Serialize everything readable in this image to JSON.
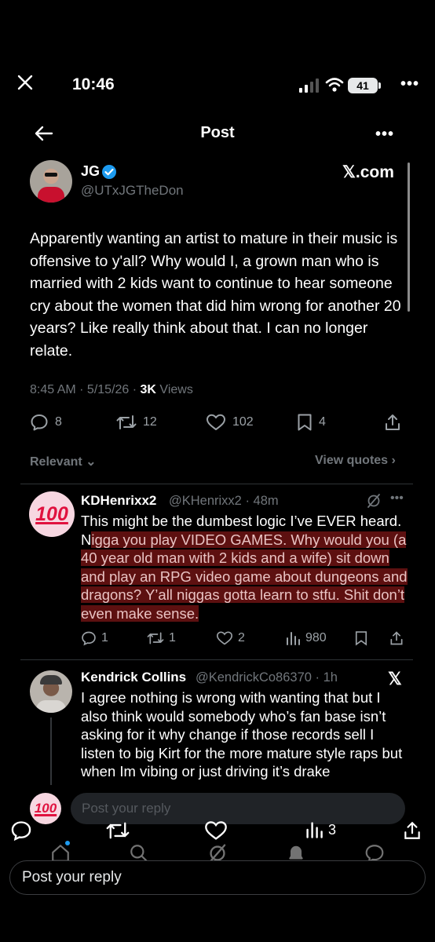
{
  "status_bar": {
    "time": "10:46",
    "battery": "41"
  },
  "header": {
    "title": "Post"
  },
  "post": {
    "author_name": "JG",
    "author_handle": "@UTxJGTheDon",
    "source_label": "𝕏.com",
    "text": "Apparently wanting an artist to mature in their music is offensive to y'all? Why would I, a grown man who is married with 2 kids want to continue to hear someone cry about the women that did him wrong for another 20 years? Like really think about that. I can no longer relate.",
    "time": "8:45 AM · 5/15/26 · ",
    "views_count": "3K",
    "views_label": " Views",
    "stats": {
      "replies": "8",
      "reposts": "12",
      "likes": "102",
      "bookmarks": "4"
    }
  },
  "sort": {
    "label": "Relevant",
    "view_quotes": "View quotes"
  },
  "replies": [
    {
      "name": "KDHenrixx2",
      "handle_time": "@KHenrixx2 · 48m",
      "avatar_text": "100",
      "text_plain": "This might be the dumbest logic I’ve EVER heard. N",
      "text_highlight": "igga you play VIDEO GAMES. Why would you (a 40 year old man with 2 kids and a wife) sit down and play an RPG video game about dungeons and dragons? Y’all niggas gotta learn to stfu. Shit don’t even make sense.",
      "stats": {
        "replies": "1",
        "reposts": "1",
        "likes": "2",
        "views": "980"
      }
    },
    {
      "name": "Kendrick Collins",
      "handle_time": "@KendrickCo86370 · 1h",
      "badge": "𝕏",
      "text": "I agree nothing is wrong with wanting that but I also think would somebody who’s fan base isn’t asking for it why change if those records sell I listen to big Kirt for the more mature style raps but when Im vibing or just driving it’s drake"
    }
  ],
  "composer": {
    "placeholder": "Post your reply",
    "avatar_text": "100"
  },
  "bottom_bar": {
    "likes_count": "3"
  },
  "reply_box": {
    "placeholder": "Post your reply"
  },
  "colors": {
    "background": "#000000",
    "verified": "#1d9bf0",
    "muted": "#71767b",
    "highlight": "#aa1e1e"
  }
}
